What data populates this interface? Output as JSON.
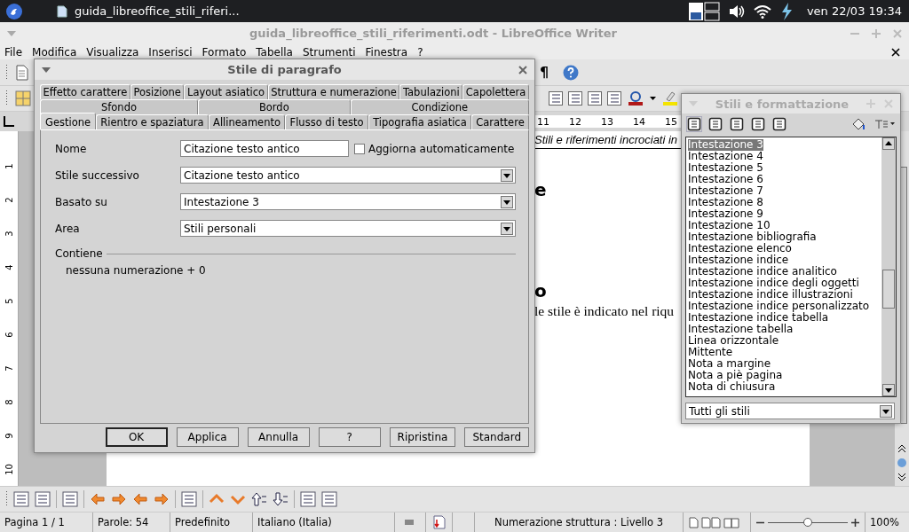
{
  "taskbar": {
    "window_button": "guida_libreoffice_stili_riferi...",
    "clock": "ven 22/03 19:34"
  },
  "window": {
    "title": "guida_libreoffice_stili_riferimenti.odt - LibreOffice Writer"
  },
  "menu": [
    "File",
    "Modifica",
    "Visualizza",
    "Inserisci",
    "Formato",
    "Tabella",
    "Strumenti",
    "Finestra",
    "?"
  ],
  "toolbar": {
    "formatting_marks": "¶"
  },
  "ruler": {
    "numbers": [
      "11",
      "12",
      "13",
      "14",
      "15"
    ]
  },
  "vertical_ruler": {
    "numbers": [
      "1",
      "2",
      "3",
      "4",
      "5",
      "6",
      "7",
      "8",
      "9",
      "10"
    ]
  },
  "document": {
    "header": "Stili e riferimenti incrociati in",
    "lines": [
      {
        "kind": "heading",
        "text": "e"
      },
      {
        "kind": "heading",
        "text": "o"
      },
      {
        "kind": "body",
        "text": "le stile è indicato nel riqu"
      }
    ]
  },
  "dialog": {
    "title": "Stile di paragrafo",
    "tab_rows": [
      [
        {
          "label": "Effetto carattere",
          "selected": false
        },
        {
          "label": "Posizione",
          "selected": false
        },
        {
          "label": "Layout asiatico",
          "selected": false
        },
        {
          "label": "Struttura e numerazione",
          "selected": false
        },
        {
          "label": "Tabulazioni",
          "selected": false
        },
        {
          "label": "Capolettera",
          "selected": false
        }
      ],
      [
        {
          "label": "Sfondo",
          "selected": false
        },
        {
          "label": "Bordo",
          "selected": false
        },
        {
          "label": "Condizione",
          "selected": false
        }
      ],
      [
        {
          "label": "Gestione",
          "selected": true
        },
        {
          "label": "Rientro e spaziatura",
          "selected": false
        },
        {
          "label": "Allineamento",
          "selected": false
        },
        {
          "label": "Flusso di testo",
          "selected": false
        },
        {
          "label": "Tipografia asiatica",
          "selected": false
        },
        {
          "label": "Carattere",
          "selected": false
        }
      ]
    ],
    "fields": [
      {
        "kind": "text",
        "label": "Nome",
        "value": "Citazione testo antico",
        "checkbox": {
          "label": "Aggiorna automaticamente",
          "checked": false
        }
      },
      {
        "kind": "dropdown",
        "label": "Stile successivo",
        "value": "Citazione testo antico"
      },
      {
        "kind": "dropdown",
        "label": "Basato su",
        "value": "Intestazione 3"
      },
      {
        "kind": "dropdown",
        "label": "Area",
        "value": "Stili personali"
      }
    ],
    "contains": {
      "heading": "Contiene",
      "text": "nessuna numerazione + 0"
    },
    "buttons": [
      {
        "label": "OK",
        "default": true
      },
      {
        "label": "Applica",
        "default": false
      },
      {
        "label": "Annulla",
        "default": false
      },
      {
        "label": "?",
        "default": false
      },
      {
        "label": "Ripristina",
        "default": false
      },
      {
        "label": "Standard",
        "default": false
      }
    ]
  },
  "styles_panel": {
    "title": "Stili e formattazione",
    "items": [
      {
        "label": "Intestazione 3",
        "selected": true
      },
      {
        "label": "Intestazione 4",
        "selected": false
      },
      {
        "label": "Intestazione 5",
        "selected": false
      },
      {
        "label": "Intestazione 6",
        "selected": false
      },
      {
        "label": "Intestazione 7",
        "selected": false
      },
      {
        "label": "Intestazione 8",
        "selected": false
      },
      {
        "label": "Intestazione 9",
        "selected": false
      },
      {
        "label": "Intestazione 10",
        "selected": false
      },
      {
        "label": "Intestazione bibliografia",
        "selected": false
      },
      {
        "label": "Intestazione elenco",
        "selected": false
      },
      {
        "label": "Intestazione indice",
        "selected": false
      },
      {
        "label": "Intestazione indice analitico",
        "selected": false
      },
      {
        "label": "Intestazione indice degli oggetti",
        "selected": false
      },
      {
        "label": "Intestazione indice illustrazioni",
        "selected": false
      },
      {
        "label": "Intestazione indice personalizzato",
        "selected": false
      },
      {
        "label": "Intestazione indice tabella",
        "selected": false
      },
      {
        "label": "Intestazione tabella",
        "selected": false
      },
      {
        "label": "Linea orizzontale",
        "selected": false
      },
      {
        "label": "Mittente",
        "selected": false
      },
      {
        "label": "Nota a margine",
        "selected": false
      },
      {
        "label": "Nota a piè pagina",
        "selected": false
      },
      {
        "label": "Nota di chiusura",
        "selected": false
      }
    ],
    "filter": "Tutti gli stili"
  },
  "status_bar": {
    "page": "Pagina 1 / 1",
    "words": "Parole: 54",
    "page_style": "Predefinito",
    "language": "Italiano (Italia)",
    "outline": "Numerazione struttura : Livello 3",
    "zoom": {
      "level": 0.5,
      "text": "100%"
    }
  }
}
